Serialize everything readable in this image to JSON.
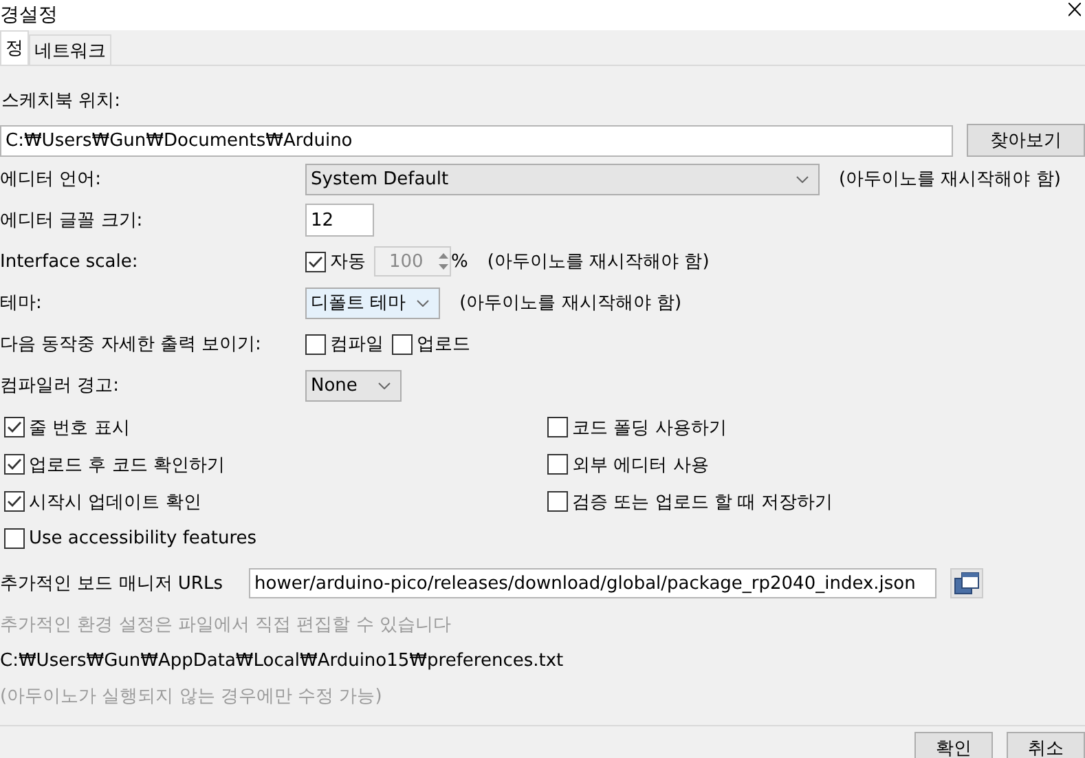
{
  "window": {
    "title": "경설정"
  },
  "tabs": [
    {
      "label": "정",
      "selected": true
    },
    {
      "label": "네트워크",
      "selected": false
    }
  ],
  "sketchbook": {
    "label": "스케치북 위치:",
    "value": "C:₩Users₩Gun₩Documents₩Arduino",
    "button": "찾아보기"
  },
  "rows": [
    {
      "kind": "wide-select",
      "label": "에디터 언어:",
      "value": "System Default",
      "focused": false,
      "note": "(아두이노를 재시작해야 함)"
    },
    {
      "kind": "number",
      "label": "에디터 글꼴 크기:",
      "value": "12"
    },
    {
      "kind": "scale",
      "label": "Interface scale:",
      "auto_label": "자동",
      "auto_checked": true,
      "value": "100",
      "unit": "%",
      "note": "(아두이노를 재시작해야 함)"
    },
    {
      "kind": "select",
      "label": "테마:",
      "value": "디폴트 테마",
      "focused": true,
      "note": "(아두이노를 재시작해야 함)"
    },
    {
      "kind": "checks",
      "label": "다음 동작중 자세한  출력 보이기:",
      "options": [
        {
          "label": "컴파일",
          "checked": false
        },
        {
          "label": "업로드",
          "checked": false
        }
      ]
    },
    {
      "kind": "select",
      "label": "컴파일러 경고:",
      "value": "None",
      "focused": false
    }
  ],
  "options_left": [
    {
      "label": "줄 번호 표시",
      "checked": true
    },
    {
      "label": "업로드 후 코드 확인하기",
      "checked": true
    },
    {
      "label": "시작시 업데이트 확인",
      "checked": true
    },
    {
      "label": "Use accessibility features",
      "checked": false
    }
  ],
  "options_right": [
    {
      "label": "코드 폴딩 사용하기",
      "checked": false
    },
    {
      "label": "외부 에디터 사용",
      "checked": false
    },
    {
      "label": "검증 또는 업로드 할 때 저장하기",
      "checked": false
    }
  ],
  "urls": {
    "label": "추가적인 보드 매니저 URLs",
    "value": "hower/arduino-pico/releases/download/global/package_rp2040_index.json"
  },
  "notes": [
    {
      "text": "추가적인 환경 설정은 파일에서 직접 편집할 수 있습니다",
      "dim": true
    },
    {
      "text": "C:₩Users₩Gun₩AppData₩Local₩Arduino15₩preferences.txt",
      "dim": false
    },
    {
      "text": "(아두이노가 실행되지 않는 경우에만 수정 가능)",
      "dim": true
    }
  ],
  "buttons": [
    "확인",
    "취소"
  ]
}
